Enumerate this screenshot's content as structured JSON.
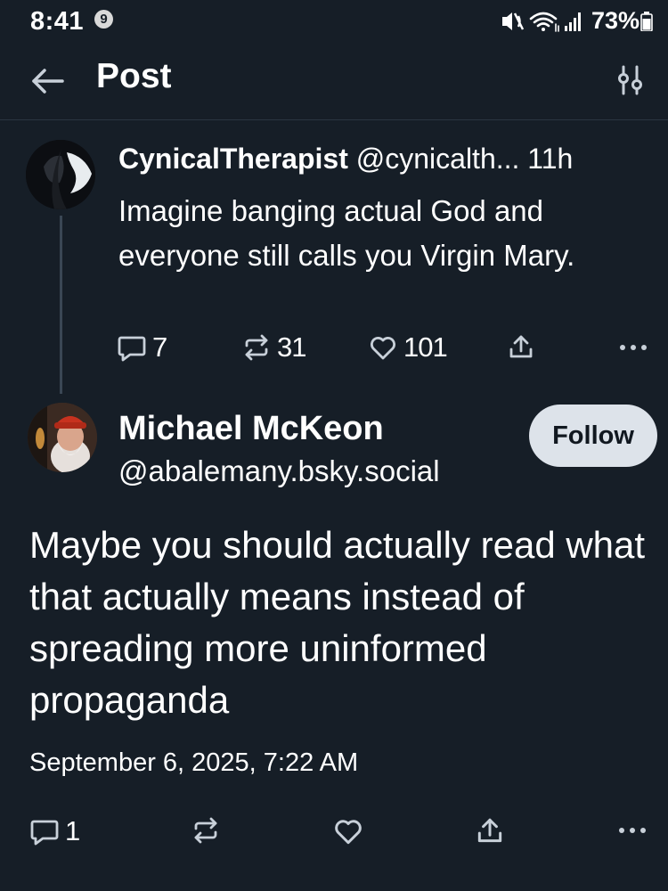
{
  "status_bar": {
    "time": "8:41",
    "notification_count": "9",
    "battery": "73%"
  },
  "header": {
    "title": "Post"
  },
  "parent_post": {
    "author_name": "CynicalTherapist",
    "author_handle": "@cynicalth...",
    "time_ago": "11h",
    "text": "Imagine banging actual God and everyone still calls you Virgin Mary.",
    "reply_count": "7",
    "repost_count": "31",
    "like_count": "101"
  },
  "reply_post": {
    "author_name": "Michael McKeon",
    "author_handle": "@abalemany.bsky.social",
    "follow_label": "Follow",
    "text": "Maybe you should actually read what that actually means instead of spreading more uninformed propaganda",
    "date": "September 6, 2025, 7:22 AM",
    "reply_count": "1"
  },
  "colors": {
    "background": "#161e27",
    "text": "#ffffff",
    "icon": "#c8d0d9",
    "follow_button_bg": "#dde3ea",
    "divider": "#2b3642"
  }
}
